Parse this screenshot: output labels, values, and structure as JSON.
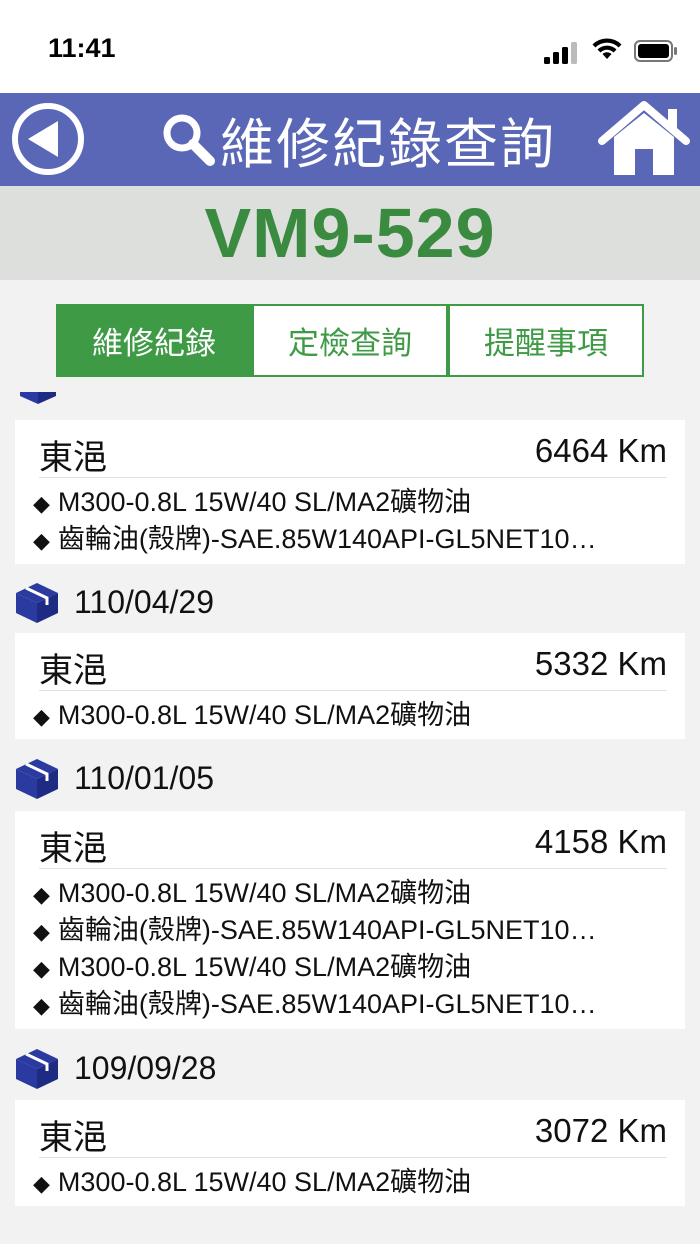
{
  "status": {
    "time": "11:41"
  },
  "nav": {
    "title": "維修紀錄查詢"
  },
  "plate": "VM9-529",
  "tabs": [
    {
      "label": "維修紀錄",
      "active": true
    },
    {
      "label": "定檢查詢",
      "active": false
    },
    {
      "label": "提醒事項",
      "active": false
    }
  ],
  "records": [
    {
      "location": "東浥",
      "km": "6464 Km",
      "items": [
        "M300-0.8L 15W/40  SL/MA2礦物油",
        "齒輪油(殼牌)-SAE.85W140API-GL5NET10…"
      ]
    },
    {
      "date": "110/04/29",
      "location": "東浥",
      "km": "5332 Km",
      "items": [
        "M300-0.8L 15W/40  SL/MA2礦物油"
      ]
    },
    {
      "date": "110/01/05",
      "location": "東浥",
      "km": "4158 Km",
      "items": [
        "M300-0.8L 15W/40  SL/MA2礦物油",
        "齒輪油(殼牌)-SAE.85W140API-GL5NET10…",
        "M300-0.8L 15W/40  SL/MA2礦物油",
        "齒輪油(殼牌)-SAE.85W140API-GL5NET10…"
      ]
    },
    {
      "date": "109/09/28",
      "location": "東浥",
      "km": "3072 Km",
      "items": [
        "M300-0.8L 15W/40  SL/MA2礦物油"
      ]
    }
  ],
  "bullet": "◆",
  "colors": {
    "nav": "#5a67b6",
    "accent_green": "#3f9a45",
    "plate_band": "#dcdfdc",
    "box_icon": "#2b3aa0"
  },
  "icons": {
    "back": "back-arrow-icon",
    "search": "search-icon",
    "home": "home-icon",
    "box": "package-box-icon"
  }
}
